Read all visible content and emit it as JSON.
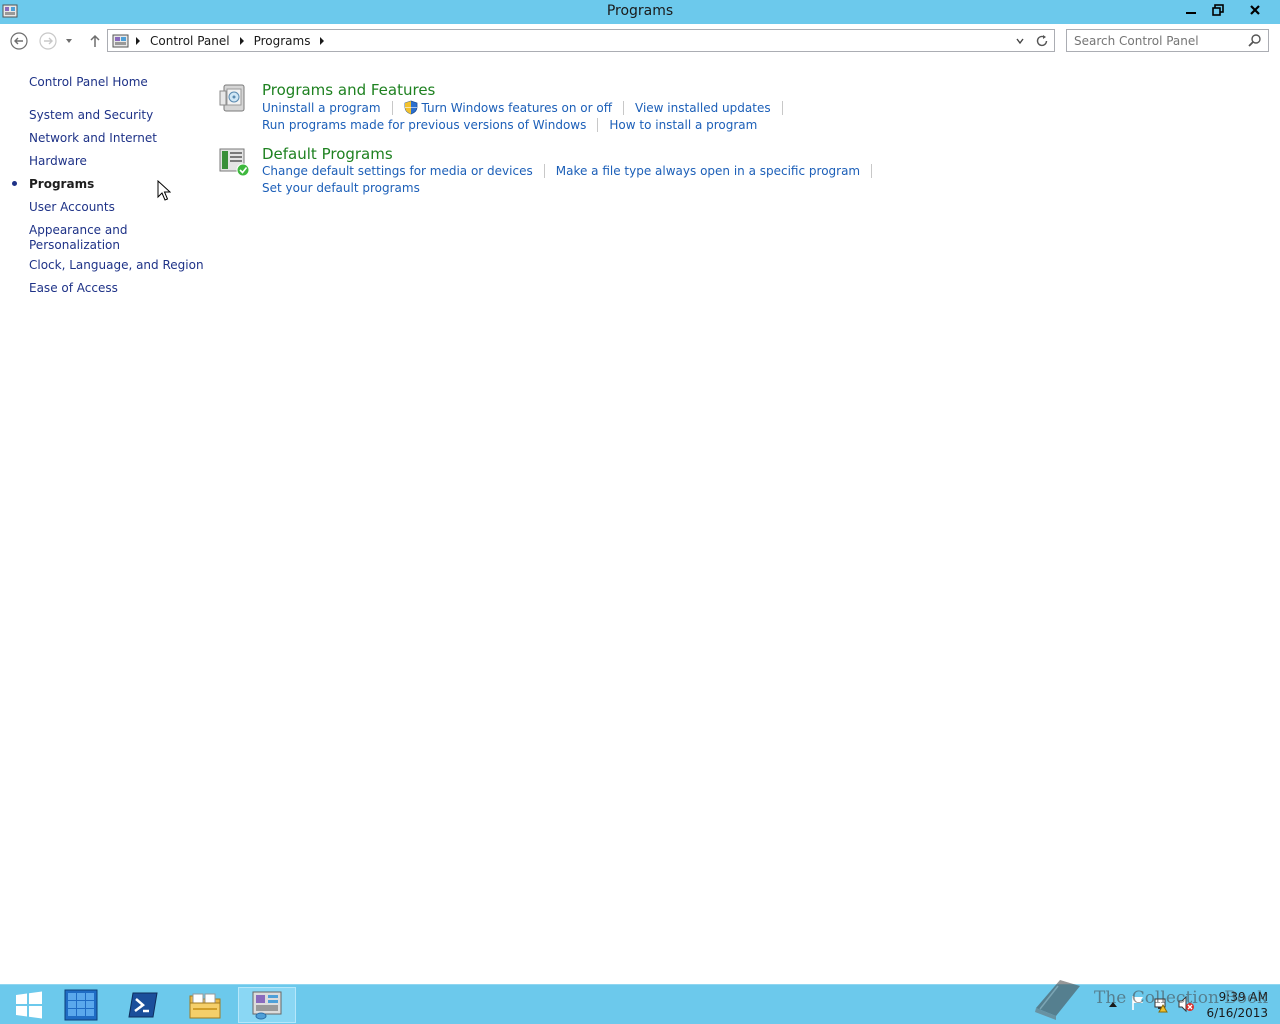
{
  "window": {
    "title": "Programs"
  },
  "address": {
    "breadcrumbs": [
      "Control Panel",
      "Programs"
    ]
  },
  "search": {
    "placeholder": "Search Control Panel"
  },
  "leftnav": {
    "items": [
      {
        "label": "Control Panel Home"
      },
      {
        "label": "System and Security"
      },
      {
        "label": "Network and Internet"
      },
      {
        "label": "Hardware"
      },
      {
        "label": "Programs",
        "current": true
      },
      {
        "label": "User Accounts"
      },
      {
        "label": "Appearance and",
        "label2": "Personalization"
      },
      {
        "label": "Clock, Language, and Region"
      },
      {
        "label": "Ease of Access"
      }
    ]
  },
  "categories": [
    {
      "title": "Programs and Features",
      "icon": "programs-features-icon",
      "lines": [
        [
          "Uninstall a program",
          "Turn Windows features on or off",
          "View installed updates"
        ],
        [
          "Run programs made for previous versions of Windows",
          "How to install a program"
        ]
      ]
    },
    {
      "title": "Default Programs",
      "icon": "default-programs-icon",
      "lines": [
        [
          "Change default settings for media or devices",
          "Make a file type always open in a specific program"
        ],
        [
          "Set your default programs"
        ]
      ]
    }
  ],
  "taskbar": {
    "clock_time": "9:39 AM",
    "clock_date": "6/16/2013"
  },
  "watermark": {
    "text": "The Collection Book"
  },
  "colors": {
    "titlebar": "#6cc9ec",
    "category_title": "#1e8120",
    "task_link": "#1c5fb8",
    "nav_link": "#1e3287"
  }
}
